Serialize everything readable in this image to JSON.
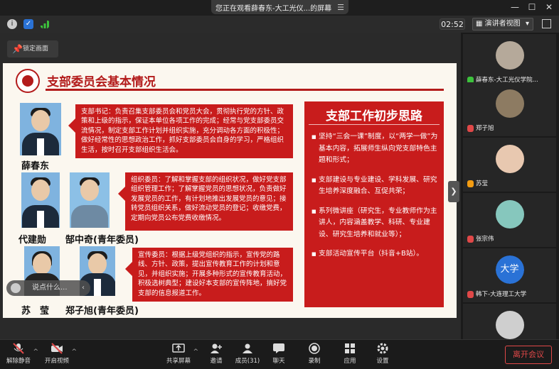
{
  "titlebar": {
    "share_notice": "您正在观看薛春东-大工光仪...的屏幕",
    "menu_glyph": "☰",
    "minimize": "—",
    "maximize": "☐",
    "close": "✕"
  },
  "infobar": {
    "timer": "02:52",
    "view_mode": "演讲者视图",
    "view_caret": "▾"
  },
  "stage": {
    "lock_label": "锁定画面",
    "comment_placeholder": "说点什么...",
    "collapse_glyph": "❯"
  },
  "slide": {
    "title": "支部委员会基本情况",
    "members": [
      {
        "name": "薛春东"
      },
      {
        "name": "代建勋"
      },
      {
        "name": "郜中奇(青年委员)"
      },
      {
        "name": "苏　莹"
      },
      {
        "name": "郑子旭(青年委员)"
      }
    ],
    "duties": [
      "支部书记：负责召集支部委员会和党员大会，贯彻执行党的方针、政策和上级的指示，保证本单位各项工作的完成；经常与党支部委员交流情况，制定支部工作计划并组织实施，充分调动各方面的积极性；做好经常性的思想政治工作，抓好支部委员会自身的学习，严格组织生活，按时召开支部组织生活会。",
      "组织委员：了解和掌握支部的组织状况，做好党支部组织管理工作；了解掌握党员的思想状况，负责做好发展党员的工作，有计划地推出发展党员的意见；接转党员组织关系，做好流动党员的登记；收缴党费，定期向党员公布党费收缴情况。",
      "宣传委员：根据上级党组织的指示，宣传党的路线、方针、政策，提出宣传教育工作的计划和意见，并组织实施；开展多种形式的宣传教育活动，积极选树典型；建设好本支部的宣传阵地，搞好党支部的信息报道工作。"
    ],
    "plan": {
      "title": "支部工作初步思路",
      "items": [
        "坚持“三会一课”制度，以“两学一做”为基本内容，拓展师生纵向党支部特色主题和形式；",
        "支部建设与专业建设、学科发展、研究生培养深度融合、互促共荣；",
        "系列微讲座（研究生，专业教师作为主讲人，内容涵盖教学、科研、专业建设、研究生培养和就业等）；",
        "支部活动宣传平台（抖音+B站）。"
      ]
    }
  },
  "gallery": {
    "participants": [
      {
        "label": "薛春东-大工光仪学院..."
      },
      {
        "label": "郑子旭"
      },
      {
        "label": "苏莹"
      },
      {
        "label": "张宗伟"
      },
      {
        "label": "韩下-大连理工大学",
        "avatar_text": "大学"
      },
      {
        "label": ""
      }
    ]
  },
  "toolbar": {
    "mute": "解除静音",
    "video": "开启视频",
    "share": "共享屏幕",
    "invite": "邀请",
    "members": "成员(31)",
    "chat": "聊天",
    "record": "录制",
    "apps": "应用",
    "settings": "设置",
    "leave": "离开会议",
    "caret": "^"
  },
  "colors": {
    "slide_red": "#c81c1c",
    "leave_red": "#e04848",
    "avatar_blue": "#2a72d6"
  }
}
